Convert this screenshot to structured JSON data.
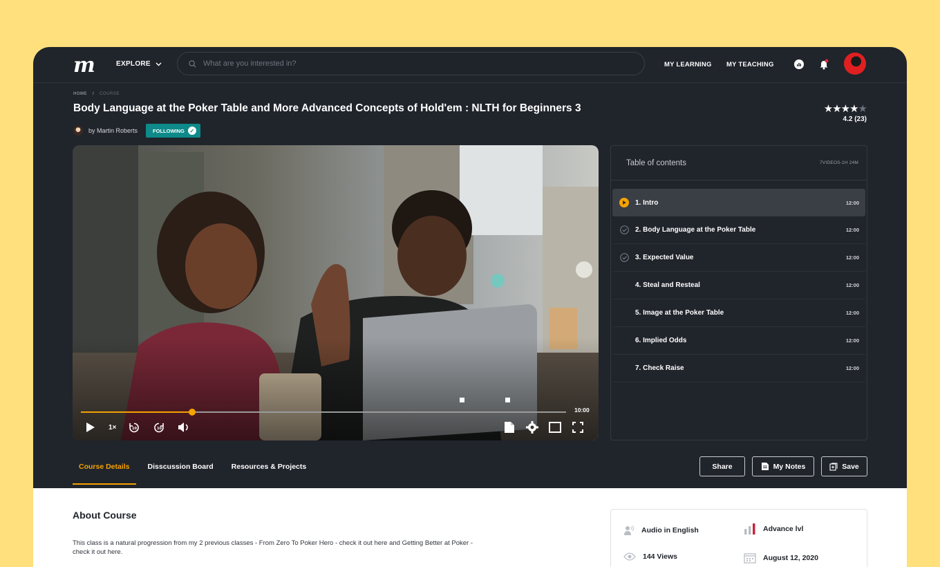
{
  "header": {
    "logo": "m",
    "explore_label": "EXPLORE",
    "search_placeholder": "What are you interested in?",
    "my_learning": "MY LEARNING",
    "my_teaching": "MY TEACHING"
  },
  "breadcrumb": {
    "home": "HOME",
    "separator": "/",
    "current": "COURSE"
  },
  "course": {
    "title": "Body Language at the Poker Table and More Advanced Concepts of Hold'em : NLTH for Beginners 3",
    "author": "by Martin Roberts",
    "following_label": "FOLLOWING",
    "stars_filled": 4,
    "stars_total": 5,
    "rating": "4.2 (23)"
  },
  "player": {
    "progress": 0.23,
    "markers": [
      0.78,
      0.875
    ],
    "time_end": "10:00",
    "speed": "1×"
  },
  "toc": {
    "title": "Table of contents",
    "meta": "7VIDEOS-1H 24M",
    "items": [
      {
        "label": "1. Intro",
        "duration": "12:00",
        "state": "playing"
      },
      {
        "label": "2. Body Language at the Poker Table",
        "duration": "12:00",
        "state": "done"
      },
      {
        "label": "3. Expected Value",
        "duration": "12:00",
        "state": "done"
      },
      {
        "label": "4. Steal and Resteal",
        "duration": "12:00",
        "state": "none"
      },
      {
        "label": "5. Image at the Poker Table",
        "duration": "12:00",
        "state": "none"
      },
      {
        "label": "6. Implied Odds",
        "duration": "12:00",
        "state": "none"
      },
      {
        "label": "7. Check Raise",
        "duration": "12:00",
        "state": "none"
      }
    ]
  },
  "tabs": [
    "Course Details",
    "Disscussion Board",
    "Resources & Projects"
  ],
  "actions": {
    "share": "Share",
    "notes": "My Notes",
    "save": "Save"
  },
  "about": {
    "title": "About Course",
    "text": "This class is a natural progression from my 2 previous classes - From Zero To Poker Hero - check it out here and Getting Better at Poker - check it out here."
  },
  "info": {
    "audio": "Audio in English",
    "level": "Advance lvl",
    "views": "144 Views",
    "date": "August 12, 2020"
  },
  "colors": {
    "accent": "#f5a300",
    "teal": "#0e8a8a",
    "background": "#ffe07d",
    "panel": "#20242b"
  }
}
